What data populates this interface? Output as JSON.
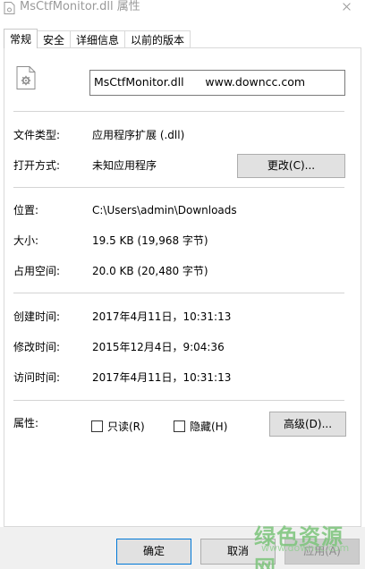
{
  "window": {
    "title": "MsCtfMonitor.dll 属性"
  },
  "tabs": [
    {
      "label": "常规",
      "active": true
    },
    {
      "label": "安全",
      "active": false
    },
    {
      "label": "详细信息",
      "active": false
    },
    {
      "label": "以前的版本",
      "active": false
    }
  ],
  "general": {
    "file_name": "MsCtfMonitor.dll      www.downcc.com",
    "file_type_label": "文件类型:",
    "file_type_value": "应用程序扩展 (.dll)",
    "open_with_label": "打开方式:",
    "open_with_value": "未知应用程序",
    "change_button": "更改(C)...",
    "location_label": "位置:",
    "location_value": "C:\\Users\\admin\\Downloads",
    "size_label": "大小:",
    "size_value": "19.5 KB (19,968 字节)",
    "size_on_disk_label": "占用空间:",
    "size_on_disk_value": "20.0 KB (20,480 字节)",
    "created_label": "创建时间:",
    "created_value": "2017年4月11日，10:31:13",
    "modified_label": "修改时间:",
    "modified_value": "2015年12月4日，9:04:36",
    "accessed_label": "访问时间:",
    "accessed_value": "2017年4月11日，10:31:13",
    "attributes_label": "属性:",
    "readonly_label": "只读(R)",
    "readonly_checked": false,
    "hidden_label": "隐藏(H)",
    "hidden_checked": false,
    "advanced_button": "高级(D)..."
  },
  "footer": {
    "ok_button": "确定",
    "cancel_button": "取消",
    "apply_button": "应用(A)"
  },
  "watermark": {
    "text": "绿色资源网",
    "sub": "www.downcc.com"
  }
}
